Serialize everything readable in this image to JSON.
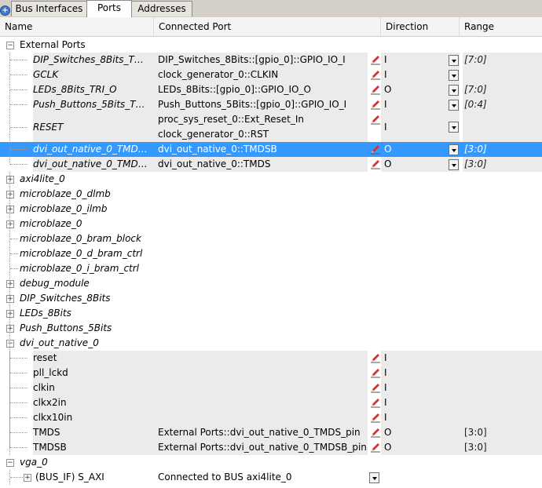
{
  "tabs": [
    {
      "label": "Bus Interfaces"
    },
    {
      "label": "Ports"
    },
    {
      "label": "Addresses"
    }
  ],
  "columns": {
    "name": "Name",
    "connected": "Connected Port",
    "direction": "Direction",
    "range": "Range"
  },
  "ext_ports": {
    "label": "External Ports",
    "rows": [
      {
        "name": "DIP_Switches_8Bits_T…",
        "conn": "DIP_Switches_8Bits::[gpio_0]::GPIO_IO_I",
        "dir": "I",
        "range": "[7:0]"
      },
      {
        "name": "GCLK",
        "conn": "clock_generator_0::CLKIN",
        "dir": "I",
        "range": ""
      },
      {
        "name": "LEDs_8Bits_TRI_O",
        "conn": "LEDs_8Bits::[gpio_0]::GPIO_IO_O",
        "dir": "O",
        "range": "[7:0]"
      },
      {
        "name": "Push_Buttons_5Bits_T…",
        "conn": "Push_Buttons_5Bits::[gpio_0]::GPIO_IO_I",
        "dir": "I",
        "range": "[0:4]"
      },
      {
        "name": "RESET",
        "conn": "proc_sys_reset_0::Ext_Reset_In",
        "conn2": "clock_generator_0::RST",
        "dir": "I",
        "range": ""
      },
      {
        "name": "dvi_out_native_0_TMD…",
        "conn": "dvi_out_native_0::TMDSB",
        "dir": "O",
        "range": "[3:0]"
      },
      {
        "name": "dvi_out_native_0_TMD…",
        "conn": "dvi_out_native_0::TMDS",
        "dir": "O",
        "range": "[3:0]"
      }
    ]
  },
  "instances": [
    "axi4lite_0",
    "microblaze_0_dlmb",
    "microblaze_0_ilmb",
    "microblaze_0",
    "microblaze_0_bram_block",
    "microblaze_0_d_bram_ctrl",
    "microblaze_0_i_bram_ctrl",
    "debug_module",
    "DIP_Switches_8Bits",
    "LEDs_8Bits",
    "Push_Buttons_5Bits"
  ],
  "dvi": {
    "label": "dvi_out_native_0",
    "rows": [
      {
        "name": "reset",
        "conn": "",
        "dir": "I",
        "range": ""
      },
      {
        "name": "pll_lckd",
        "conn": "",
        "dir": "I",
        "range": ""
      },
      {
        "name": "clkin",
        "conn": "",
        "dir": "I",
        "range": ""
      },
      {
        "name": "clkx2in",
        "conn": "",
        "dir": "I",
        "range": ""
      },
      {
        "name": "clkx10in",
        "conn": "",
        "dir": "I",
        "range": ""
      },
      {
        "name": "TMDS",
        "conn": "External Ports::dvi_out_native_0_TMDS_pin",
        "dir": "O",
        "range": "[3:0]"
      },
      {
        "name": "TMDSB",
        "conn": "External Ports::dvi_out_native_0_TMDSB_pin",
        "dir": "O",
        "range": "[3:0]"
      }
    ]
  },
  "vga": {
    "label": "vga_0",
    "bus_if": "(BUS_IF) S_AXI",
    "bus_conn": "Connected to BUS axi4lite_0"
  },
  "colors": {
    "selection": "#3399ff",
    "pencil": "#d93030",
    "range_text": "#1a1a1a"
  }
}
